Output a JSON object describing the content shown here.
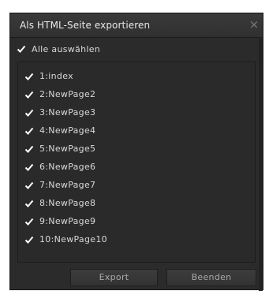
{
  "dialog": {
    "title": "Als HTML-Seite exportieren",
    "close_icon": "×"
  },
  "select_all": {
    "label": "Alle auswählen",
    "checked": true
  },
  "pages": [
    {
      "label": "1:index",
      "checked": true
    },
    {
      "label": "2:NewPage2",
      "checked": true
    },
    {
      "label": "3:NewPage3",
      "checked": true
    },
    {
      "label": "4:NewPage4",
      "checked": true
    },
    {
      "label": "5:NewPage5",
      "checked": true
    },
    {
      "label": "6:NewPage6",
      "checked": true
    },
    {
      "label": "7:NewPage7",
      "checked": true
    },
    {
      "label": "8:NewPage8",
      "checked": true
    },
    {
      "label": "9:NewPage9",
      "checked": true
    },
    {
      "label": "10:NewPage10",
      "checked": true
    }
  ],
  "buttons": {
    "export": "Export",
    "close": "Beenden"
  },
  "colors": {
    "dialog_bg": "#2b2b2b",
    "text": "#d8d8d8",
    "checkmark": "#ffffff"
  },
  "icons": {
    "checkbox": "checkmark-icon",
    "close": "close-icon"
  }
}
